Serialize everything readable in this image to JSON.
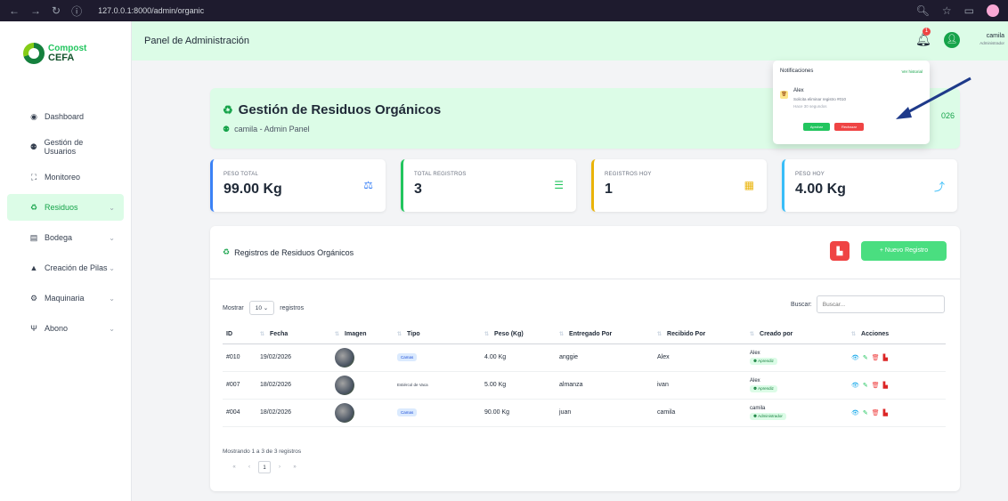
{
  "browser": {
    "url": "127.0.0.1:8000/admin/organic"
  },
  "brand": {
    "line1": "Compost",
    "line2": "CEFA"
  },
  "sidebar": {
    "items": [
      {
        "label": "Dashboard",
        "icon": "dashboard-icon",
        "glyph": "◉",
        "active": false,
        "has_chevron": false
      },
      {
        "label": "Gestión de Usuarios",
        "icon": "users-icon",
        "glyph": "⚉",
        "active": false,
        "has_chevron": false
      },
      {
        "label": "Monitoreo",
        "icon": "chart-icon",
        "glyph": "⛶",
        "active": false,
        "has_chevron": false
      },
      {
        "label": "Residuos",
        "icon": "recycle-icon",
        "glyph": "♻",
        "active": true,
        "has_chevron": true
      },
      {
        "label": "Bodega",
        "icon": "warehouse-icon",
        "glyph": "▤",
        "active": false,
        "has_chevron": true
      },
      {
        "label": "Creación de Pilas",
        "icon": "pile-icon",
        "glyph": "▲",
        "active": false,
        "has_chevron": true
      },
      {
        "label": "Maquinaria",
        "icon": "gears-icon",
        "glyph": "⚙",
        "active": false,
        "has_chevron": true
      },
      {
        "label": "Abono",
        "icon": "seedling-icon",
        "glyph": "Ψ",
        "active": false,
        "has_chevron": true
      }
    ]
  },
  "header": {
    "title": "Panel de Administración",
    "notification_count": "1",
    "user_name": "camila",
    "user_role": "Administrador"
  },
  "hero": {
    "title": "Gestión de Residuos Orgánicos",
    "subtitle": "camila - Admin Panel",
    "year_fragment": "026"
  },
  "stats": [
    {
      "label": "Peso Total",
      "value": "99.00 Kg",
      "accent": "#3b82f6",
      "icon": "scale-icon",
      "glyph": "⚖"
    },
    {
      "label": "Total Registros",
      "value": "3",
      "accent": "#22c55e",
      "icon": "list-icon",
      "glyph": "☰"
    },
    {
      "label": "Registros Hoy",
      "value": "1",
      "accent": "#eab308",
      "icon": "calendar-icon",
      "glyph": "▦"
    },
    {
      "label": "Peso Hoy",
      "value": "4.00 Kg",
      "accent": "#38bdf8",
      "icon": "trend-icon",
      "glyph": "⤴"
    }
  ],
  "records": {
    "title": "Registros de Residuos Orgánicos",
    "pdf_button": "",
    "new_button": "+ Nuevo Registro",
    "show_label": "Mostrar",
    "show_value": "10",
    "show_suffix": "registros",
    "search_label": "Buscar:",
    "search_placeholder": "Buscar...",
    "columns": [
      "ID",
      "Fecha",
      "Imagen",
      "Tipo",
      "Peso (Kg)",
      "Entregado Por",
      "Recibido Por",
      "Creado por",
      "Acciones"
    ],
    "rows": [
      {
        "id": "#010",
        "fecha": "19/02/2026",
        "tipo": "Camas",
        "tipo_pill": true,
        "peso": "4.00 Kg",
        "entregado": "anggie",
        "recibido": "Alex",
        "creador": "Alex",
        "rol": "Aprendiz"
      },
      {
        "id": "#007",
        "fecha": "18/02/2026",
        "tipo": "Estiércol de Vaca",
        "tipo_pill": false,
        "peso": "5.00 Kg",
        "entregado": "almanza",
        "recibido": "ivan",
        "creador": "Alex",
        "rol": "Aprendiz"
      },
      {
        "id": "#004",
        "fecha": "18/02/2026",
        "tipo": "Camas",
        "tipo_pill": true,
        "peso": "90.00 Kg",
        "entregado": "juan",
        "recibido": "camila",
        "creador": "camila",
        "rol": "Administrador"
      }
    ],
    "footer_info": "Mostrando 1 a 3 de 3 registros",
    "current_page": "1"
  },
  "notifications": {
    "heading": "Notificaciones",
    "history_link": "Ver historial",
    "user": "Alex",
    "message": "Solicita eliminar registro #010",
    "time": "Hace 30 segundos",
    "approve": "Aprobar",
    "reject": "Rechazar"
  }
}
